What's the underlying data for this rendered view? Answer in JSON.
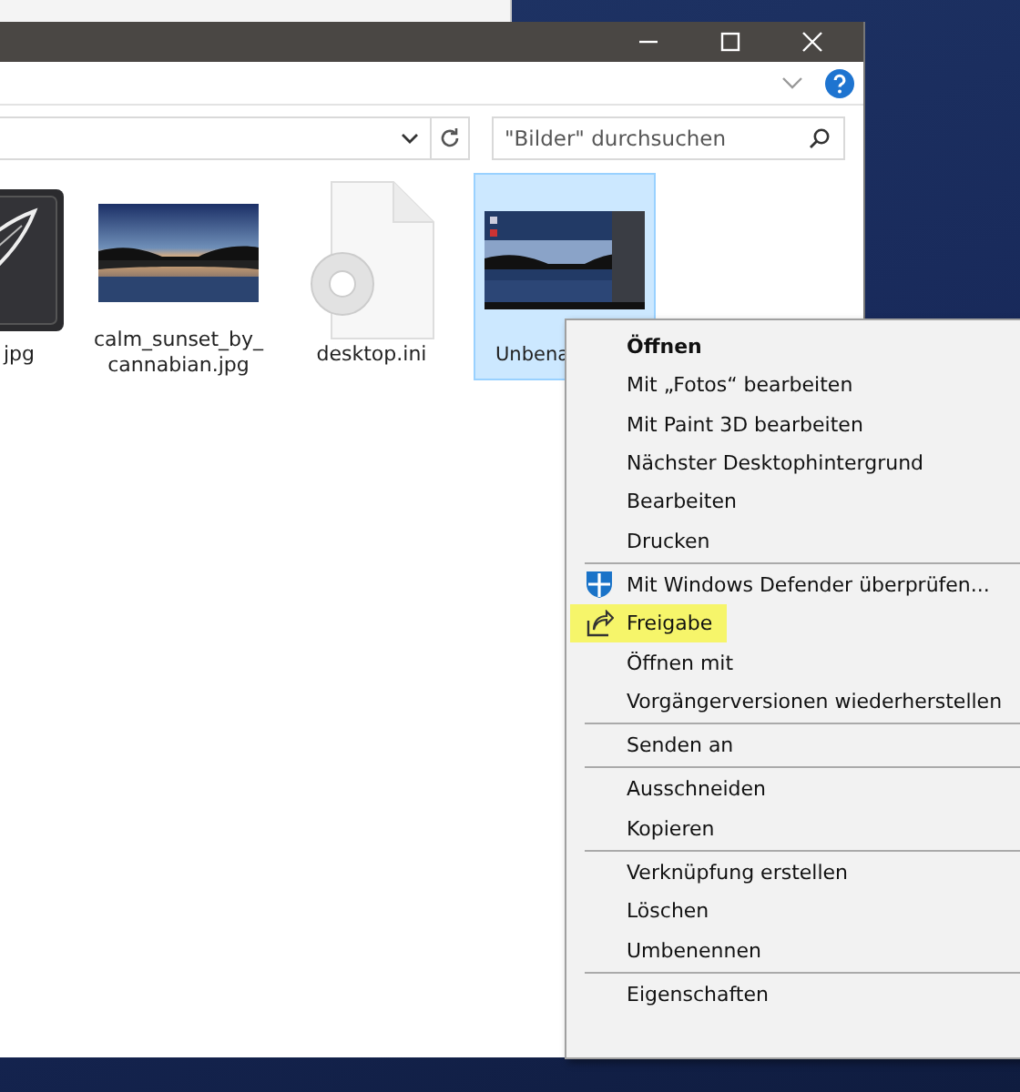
{
  "window": {
    "search": {
      "placeholder": "\"Bilder\" durchsuchen"
    },
    "files": [
      {
        "kind": "artwork",
        "lines": [
          "jpg"
        ],
        "selected": false
      },
      {
        "lines": [
          "calm_sunset_by_",
          "cannabian.jpg"
        ],
        "selected": false
      },
      {
        "kind": "settings",
        "lines": [
          "desktop.ini"
        ],
        "selected": false
      },
      {
        "kind": "screenshot",
        "lines": [
          "Unbena"
        ],
        "selected": true
      }
    ]
  },
  "context_menu": {
    "groups": [
      [
        {
          "label": "Öffnen",
          "default": true,
          "highlighted": false
        },
        {
          "label": "Mit „Fotos“ bearbeiten",
          "default": false,
          "highlighted": false
        },
        {
          "label": "Mit Paint 3D bearbeiten",
          "default": false,
          "highlighted": false
        },
        {
          "label": "Nächster Desktophintergrund",
          "default": false,
          "highlighted": false
        },
        {
          "label": "Bearbeiten",
          "default": false,
          "highlighted": false
        },
        {
          "label": "Drucken",
          "default": false,
          "highlighted": false
        }
      ],
      [
        {
          "label": "Mit Windows Defender überprüfen...",
          "kind": "shield",
          "default": false,
          "highlighted": false
        },
        {
          "label": "Freigabe",
          "kind": "share",
          "default": false,
          "highlighted": true
        },
        {
          "label": "Öffnen mit",
          "default": false,
          "highlighted": false
        },
        {
          "label": "Vorgängerversionen wiederherstellen",
          "default": false,
          "highlighted": false
        }
      ],
      [
        {
          "label": "Senden an",
          "default": false,
          "highlighted": false
        }
      ],
      [
        {
          "label": "Ausschneiden",
          "default": false,
          "highlighted": false
        },
        {
          "label": "Kopieren",
          "default": false,
          "highlighted": false
        }
      ],
      [
        {
          "label": "Verknüpfung erstellen",
          "default": false,
          "highlighted": false
        },
        {
          "label": "Löschen",
          "default": false,
          "highlighted": false
        },
        {
          "label": "Umbenennen",
          "default": false,
          "highlighted": false
        }
      ],
      [
        {
          "label": "Eigenschaften",
          "default": false,
          "highlighted": false
        }
      ]
    ]
  }
}
